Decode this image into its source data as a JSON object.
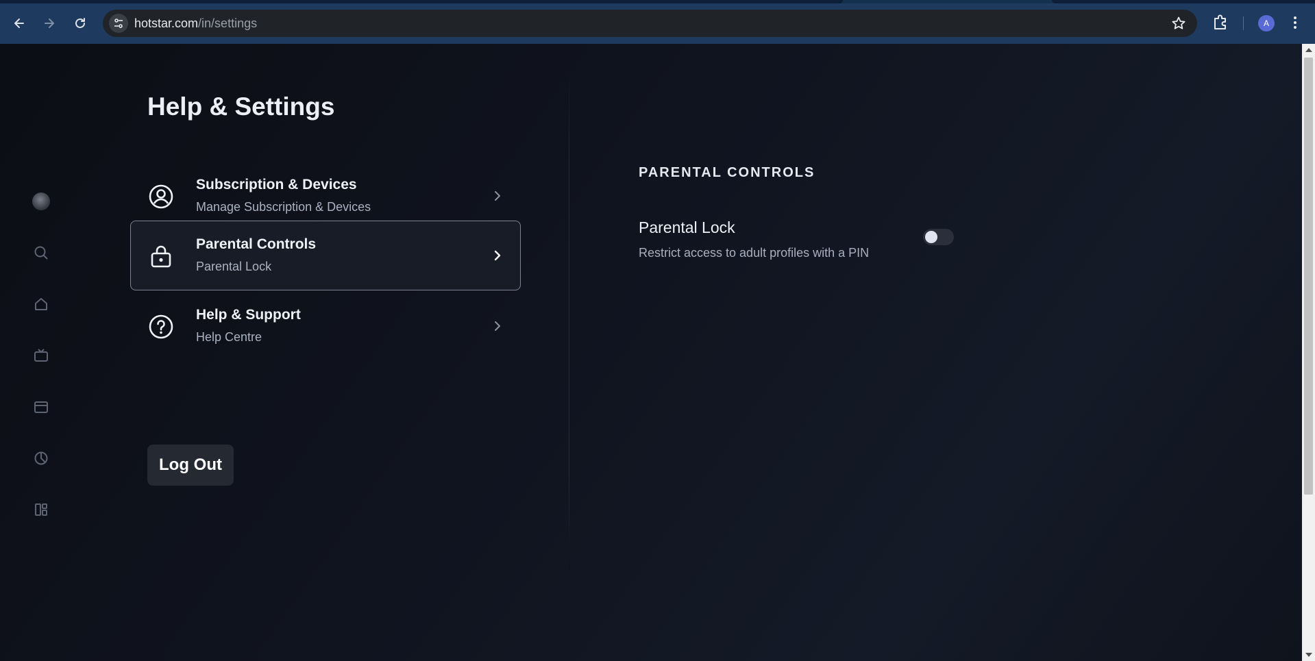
{
  "browser": {
    "url_host": "hotstar.com",
    "url_path": "/in/settings",
    "profile_initial": "A"
  },
  "rail": {
    "icons": [
      "profile-avatar",
      "search-icon",
      "home-icon",
      "tv-icon",
      "folder-icon",
      "sports-icon",
      "categories-icon"
    ]
  },
  "page": {
    "title": "Help & Settings",
    "menu": [
      {
        "title": "Subscription & Devices",
        "subtitle": "Manage Subscription & Devices"
      },
      {
        "title": "Parental Controls",
        "subtitle": "Parental Lock"
      },
      {
        "title": "Help & Support",
        "subtitle": "Help Centre"
      }
    ],
    "logout_label": "Log Out"
  },
  "parental": {
    "section_title": "PARENTAL CONTROLS",
    "lock_title": "Parental Lock",
    "lock_description": "Restrict access to adult profiles with a PIN",
    "lock_enabled": false
  },
  "colors": {
    "accent_profile": "#5b6bd6",
    "chrome_bar": "#1f3a5f",
    "page_bg": "#0f1014"
  }
}
